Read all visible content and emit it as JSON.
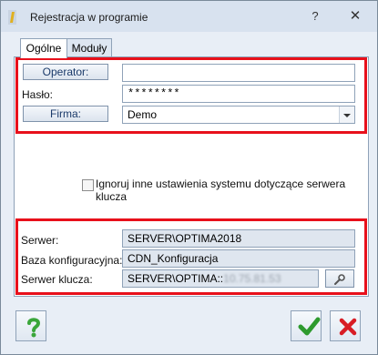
{
  "window": {
    "title": "Rejestracja w programie"
  },
  "tabs": [
    {
      "label": "Ogólne"
    },
    {
      "label": "Moduły"
    }
  ],
  "login": {
    "operator_button": "Operator:",
    "operator_value": "",
    "password_label": "Hasło:",
    "password_value": "********",
    "company_button": "Firma:",
    "company_value": "Demo"
  },
  "options": {
    "ignore_key_server_label": "Ignoruj inne ustawienia systemu dotyczące serwera klucza",
    "ignore_key_server_checked": false
  },
  "server_info": {
    "server_label": "Serwer:",
    "server_value": "SERVER\\OPTIMA2018",
    "config_db_label": "Baza konfiguracyjna:",
    "config_db_value": "CDN_Konfiguracja",
    "key_server_label": "Serwer klucza:",
    "key_server_value": "SERVER\\OPTIMA::",
    "key_server_value_obscured": "10.75.81.53"
  },
  "colors": {
    "highlight_box": "#e8101b",
    "help_icon": "#3aa63a",
    "ok_icon": "#2e9a2e",
    "cancel_icon": "#d81c24"
  },
  "icons": {
    "help": "question-mark-icon",
    "ok": "checkmark-icon",
    "cancel": "x-icon",
    "key_server_browse": "wrench-icon"
  }
}
